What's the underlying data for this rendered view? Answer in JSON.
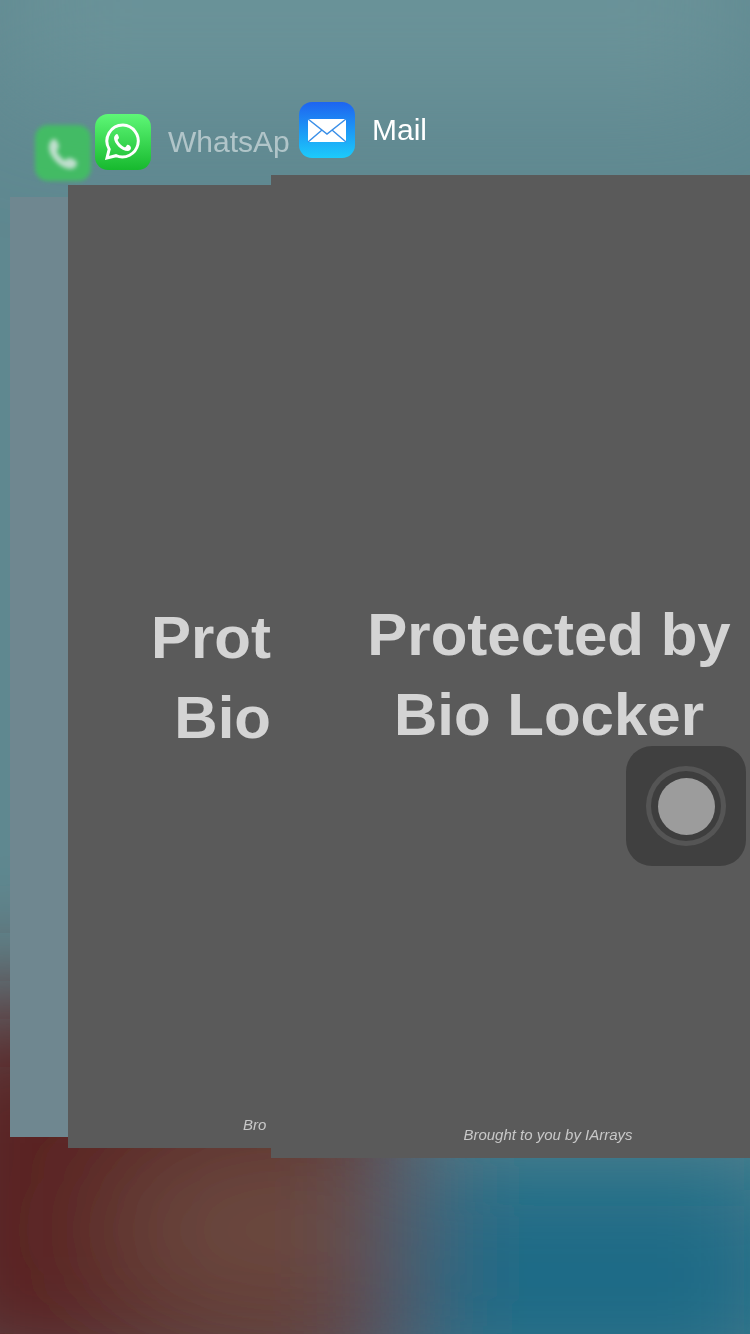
{
  "cards": [
    {
      "kind": "phone"
    },
    {
      "kind": "whatsapp",
      "label": "WhatsAp",
      "headline": [
        "Prot",
        "Bio"
      ],
      "footer": "Bro"
    },
    {
      "kind": "mail",
      "label": "Mail",
      "headline": [
        "Protected by",
        "Bio Locker"
      ],
      "footer": "Brought to you by IArrays"
    }
  ],
  "assistive_touch": {
    "kind": "home-button"
  }
}
